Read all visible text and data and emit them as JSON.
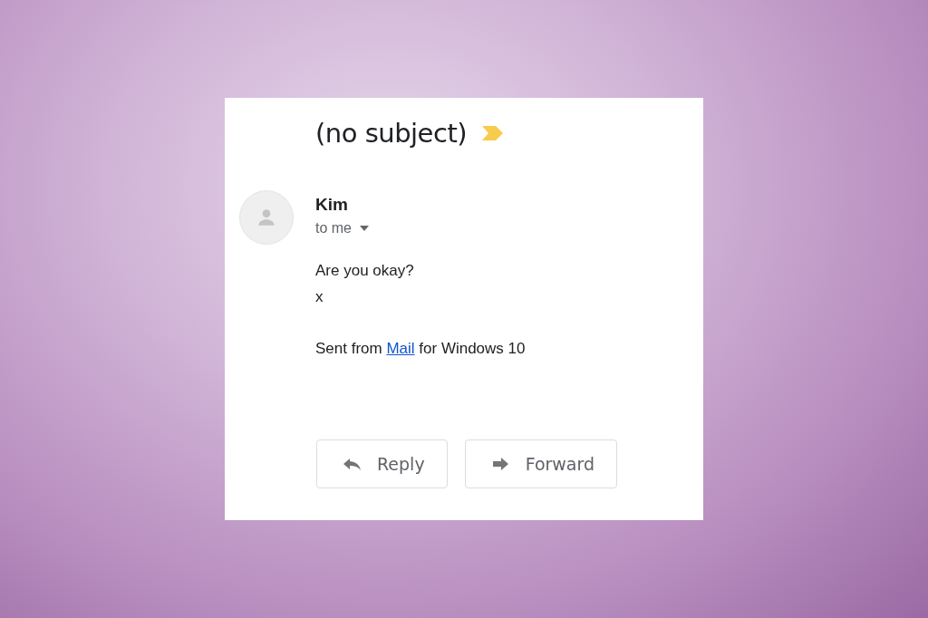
{
  "email": {
    "subject": "(no subject)",
    "important": true,
    "sender": {
      "name": "Kim",
      "recipient": "to me"
    },
    "body": [
      "Are you okay?",
      "x"
    ],
    "signature": {
      "before": "Sent from ",
      "link": "Mail",
      "after": " for Windows 10"
    },
    "actions": [
      {
        "kind": "reply",
        "label": "Reply"
      },
      {
        "kind": "forward",
        "label": "Forward"
      }
    ]
  }
}
